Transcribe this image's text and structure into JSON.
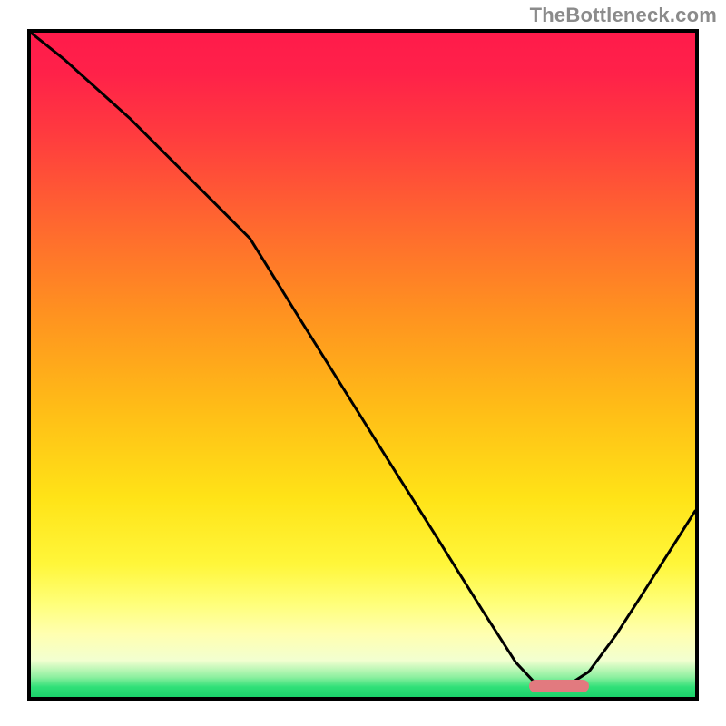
{
  "watermark": "TheBottleneck.com",
  "plot": {
    "inner_width": 732,
    "inner_height": 732
  },
  "gradient_stops": [
    {
      "offset": 0.0,
      "color": "#ff1b4b"
    },
    {
      "offset": 0.06,
      "color": "#ff2149"
    },
    {
      "offset": 0.15,
      "color": "#ff3a3f"
    },
    {
      "offset": 0.28,
      "color": "#ff6530"
    },
    {
      "offset": 0.42,
      "color": "#ff9120"
    },
    {
      "offset": 0.56,
      "color": "#ffbb17"
    },
    {
      "offset": 0.7,
      "color": "#ffe317"
    },
    {
      "offset": 0.8,
      "color": "#fff63a"
    },
    {
      "offset": 0.86,
      "color": "#ffff7a"
    },
    {
      "offset": 0.905,
      "color": "#ffffb0"
    },
    {
      "offset": 0.945,
      "color": "#f2ffd0"
    },
    {
      "offset": 0.97,
      "color": "#8ef0a0"
    },
    {
      "offset": 0.985,
      "color": "#30e078"
    },
    {
      "offset": 1.0,
      "color": "#1bd36b"
    }
  ],
  "chart_data": {
    "type": "line",
    "title": "",
    "xlabel": "",
    "ylabel": "",
    "xlim": [
      0,
      100
    ],
    "ylim": [
      0,
      100
    ],
    "grid": false,
    "legend": false,
    "series": [
      {
        "name": "curve",
        "x": [
          0,
          5,
          10,
          15,
          20,
          25,
          30,
          33,
          40,
          47,
          54,
          61,
          68,
          73,
          76,
          80,
          84,
          88,
          92,
          96,
          100
        ],
        "y": [
          100,
          96,
          91.5,
          87,
          82,
          77,
          72,
          69,
          57.7,
          46.5,
          35.3,
          24.2,
          13,
          5.2,
          2,
          1.2,
          3.8,
          9.2,
          15.4,
          21.7,
          28
        ]
      }
    ],
    "marker": {
      "shape": "rounded-bar",
      "x_start": 75,
      "x_end": 84,
      "y": 1.6,
      "color": "#e27a7f"
    }
  }
}
